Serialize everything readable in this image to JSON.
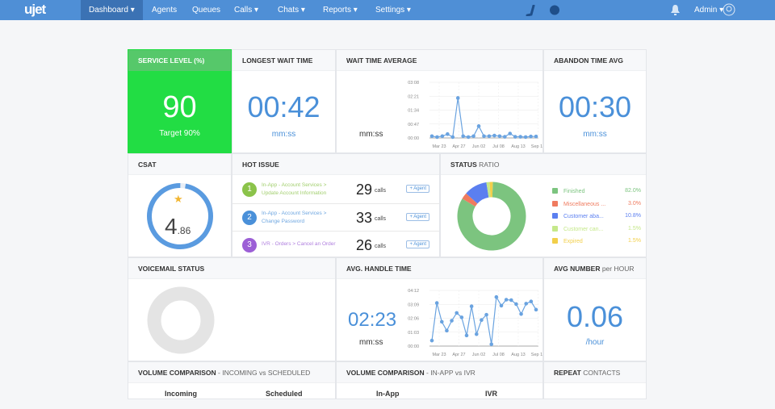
{
  "nav": {
    "logo": "ujet",
    "items": [
      "Dashboard ▾",
      "Agents",
      "Queues",
      "Calls ▾",
      "Chats ▾",
      "Reports ▾",
      "Settings ▾"
    ],
    "user": "Admin ▾",
    "icons": [
      "phone-icon",
      "chat-icon",
      "bell-icon",
      "avatar-icon"
    ]
  },
  "service_level": {
    "title": "SERVICE LEVEL (%)",
    "value": "90",
    "target": "Target 90%",
    "color": "#22dd44"
  },
  "longest_wait": {
    "title": "LONGEST WAIT TIME",
    "value": "00:42",
    "unit": "mm:ss"
  },
  "wait_avg": {
    "title": "WAIT TIME AVERAGE",
    "unit": "mm:ss"
  },
  "abandon": {
    "title": "ABANDON TIME AVG",
    "value": "00:30",
    "unit": "mm:ss"
  },
  "csat": {
    "title": "CSAT",
    "value_int": "4",
    "value_dec": ".86",
    "fraction": 0.972
  },
  "hot_issue": {
    "title": "HOT ISSUE",
    "calls_label": "calls",
    "agent_label": "+ Agent",
    "items": [
      {
        "rank": "1",
        "line1": "In-App - Account Services >",
        "line2": "Update Account Information",
        "count": "29",
        "color": "#8bc34a"
      },
      {
        "rank": "2",
        "line1": "In-App - Account Services >",
        "line2": "Change Password",
        "count": "33",
        "color": "#4a90d9"
      },
      {
        "rank": "3",
        "line1": "IVR - Orders > Cancel an Order",
        "line2": "",
        "count": "26",
        "color": "#9c5fd6"
      }
    ]
  },
  "status_ratio": {
    "title_bold": "STATUS",
    "title_light": " RATIO",
    "items": [
      {
        "label": "Finished",
        "value": "82.0%",
        "pct": 82.0,
        "color": "#7cc47f"
      },
      {
        "label": "Miscellaneous ...",
        "value": "3.0%",
        "pct": 3.0,
        "color": "#ef7b5f"
      },
      {
        "label": "Customer aba...",
        "value": "10.8%",
        "pct": 10.8,
        "color": "#5b7ff0"
      },
      {
        "label": "Customer can...",
        "value": "1.5%",
        "pct": 1.5,
        "color": "#c5e88a"
      },
      {
        "label": "Expired",
        "value": "1.5%",
        "pct": 1.5,
        "color": "#f2cf4a"
      }
    ]
  },
  "voicemail": {
    "title": "VOICEMAIL STATUS"
  },
  "handle": {
    "title": "AVG. HANDLE TIME",
    "value": "02:23",
    "unit": "mm:ss"
  },
  "avg_number": {
    "title_bold": "AVG NUMBER",
    "title_light": " per HOUR",
    "value": "0.06",
    "unit": "/hour"
  },
  "vol1": {
    "title_bold": "VOLUME COMPARISON",
    "title_light": " - INCOMING vs SCHEDULED",
    "col1": "Incoming",
    "col2": "Scheduled"
  },
  "vol2": {
    "title_bold": "VOLUME COMPARISON",
    "title_light": " - IN-APP vs IVR",
    "col1": "In-App",
    "col2": "IVR"
  },
  "repeat": {
    "title_bold": "REPEAT",
    "title_light": " CONTACTS"
  },
  "chart_data": [
    {
      "type": "line",
      "title": "WAIT TIME AVERAGE",
      "yticks": [
        "00:00",
        "00:47",
        "01:34",
        "02:21",
        "03:08"
      ],
      "ylim": [
        0,
        188
      ],
      "xticks": [
        "Mar 23",
        "Apr 27",
        "Jun 02",
        "Jul 08",
        "Aug 13",
        "Sep 18"
      ],
      "values": [
        6,
        3,
        6,
        13,
        3,
        135,
        6,
        3,
        6,
        40,
        6,
        6,
        8,
        6,
        4,
        15,
        4,
        4,
        3,
        5,
        5
      ]
    },
    {
      "type": "line",
      "title": "AVG. HANDLE TIME",
      "yticks": [
        "00:00",
        "01:03",
        "02:06",
        "03:09",
        "04:12"
      ],
      "ylim": [
        0,
        252
      ],
      "xticks": [
        "Mar 23",
        "Apr 27",
        "Jun 02",
        "Jul 08",
        "Aug 13",
        "Sep 18"
      ],
      "values": [
        25,
        195,
        110,
        70,
        115,
        150,
        130,
        48,
        180,
        54,
        118,
        142,
        8,
        222,
        183,
        210,
        208,
        190,
        145,
        192,
        202,
        165
      ]
    }
  ]
}
